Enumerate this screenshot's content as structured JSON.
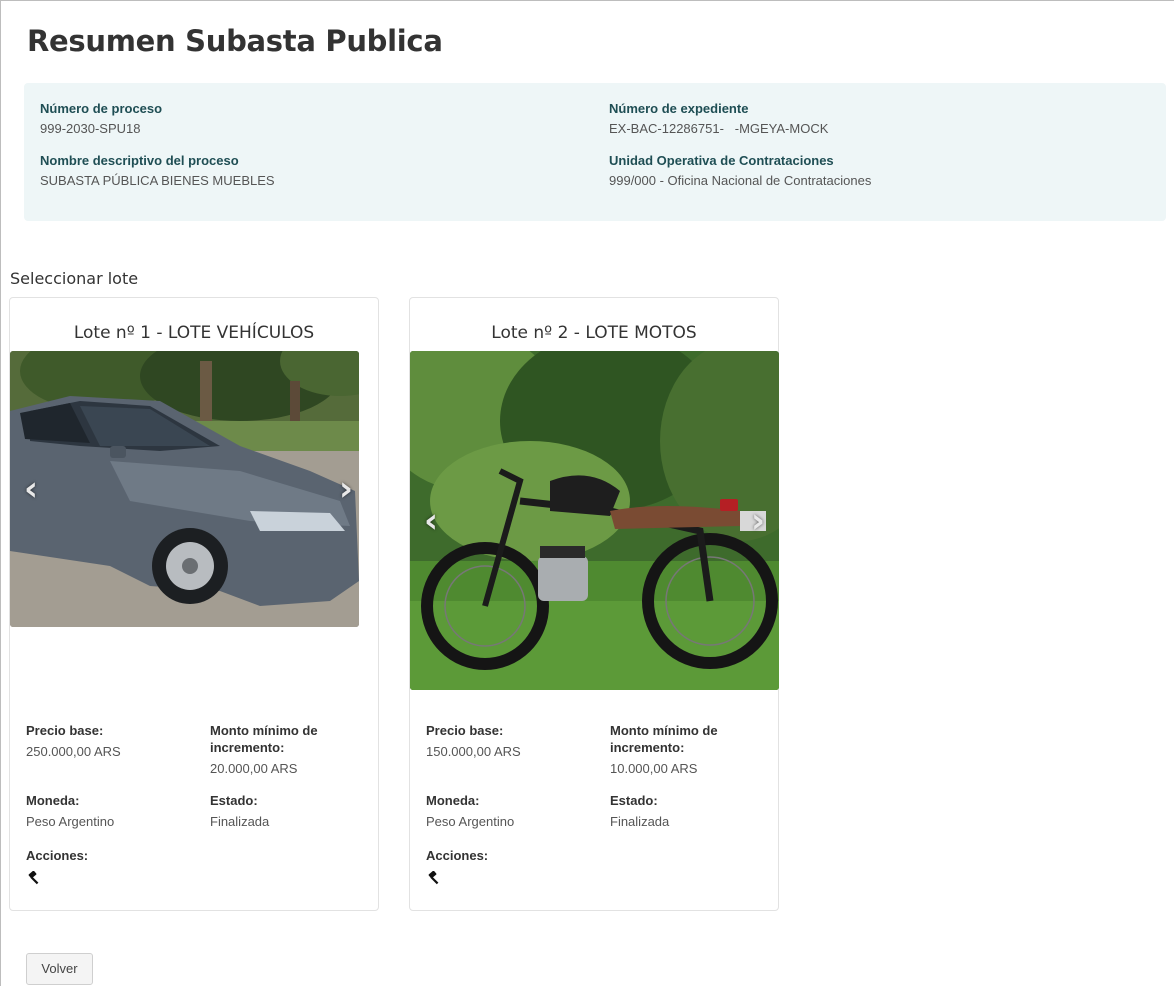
{
  "page": {
    "title": "Resumen Subasta Publica"
  },
  "summary": {
    "process_number_label": "Número de proceso",
    "process_number": "999-2030-SPU18",
    "file_number_label": "Número de expediente",
    "file_number": "EX-BAC-12286751-   -MGEYA-MOCK",
    "description_label": "Nombre descriptivo del proceso",
    "description": "SUBASTA PÚBLICA BIENES MUEBLES",
    "unit_label": "Unidad Operativa de Contrataciones",
    "unit": "999/000 - Oficina Nacional de Contrataciones"
  },
  "lots_section": {
    "label": "Seleccionar lote"
  },
  "field_labels": {
    "base_price": "Precio base:",
    "min_increment": "Monto mínimo de incremento:",
    "currency": "Moneda:",
    "status": "Estado:",
    "actions": "Acciones:"
  },
  "lots": [
    {
      "title": "Lote nº 1 - LOTE VEHÍCULOS",
      "image": "car-photo",
      "base_price": "250.000,00 ARS",
      "min_increment": "20.000,00 ARS",
      "currency": "Peso Argentino",
      "status": "Finalizada",
      "action_icon": "gavel-icon"
    },
    {
      "title": "Lote nº 2 - LOTE MOTOS",
      "image": "motorcycle-photo",
      "base_price": "150.000,00 ARS",
      "min_increment": "10.000,00 ARS",
      "currency": "Peso Argentino",
      "status": "Finalizada",
      "action_icon": "gavel-icon"
    }
  ],
  "carousel": {
    "prev": "‹",
    "next": "›"
  },
  "footer": {
    "back_label": "Volver"
  },
  "colors": {
    "panel_bg": "#eef6f7",
    "label_accent": "#1f4e54"
  }
}
